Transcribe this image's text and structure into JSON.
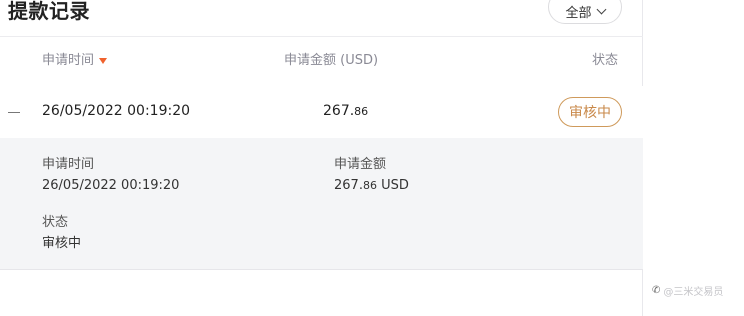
{
  "header": {
    "title": "提款记录",
    "filter_label": "全部"
  },
  "table": {
    "columns": {
      "time": "申请时间",
      "amount": "申请金额 (USD)",
      "status": "状态"
    },
    "row": {
      "time": "26/05/2022 00:19:20",
      "amount_main": "267.",
      "amount_cents": "86",
      "status": "审核中"
    }
  },
  "detail": {
    "time_label": "申请时间",
    "time_value": "26/05/2022 00:19:20",
    "amount_label": "申请金额",
    "amount_main": "267.",
    "amount_cents": "86",
    "amount_currency": " USD",
    "status_label": "状态",
    "status_value": "审核中"
  },
  "watermark": {
    "text": "@三米交易员"
  },
  "colors": {
    "sort_arrow": "#f0622d",
    "status_badge": "#c9894a",
    "detail_bg": "#f4f5f7"
  }
}
